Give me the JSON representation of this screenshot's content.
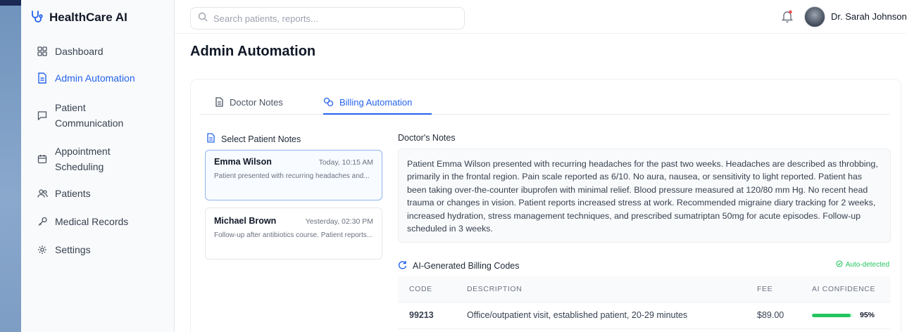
{
  "app": {
    "name": "HealthCare AI"
  },
  "sidebar": {
    "items": [
      {
        "label": "Dashboard",
        "icon": "grid-icon",
        "active": false
      },
      {
        "label": "Admin Automation",
        "icon": "document-icon",
        "active": true
      },
      {
        "label_line1": "Patient",
        "label_line2": "Communication",
        "icon": "message-icon",
        "active": false
      },
      {
        "label_line1": "Appointment",
        "label_line2": "Scheduling",
        "icon": "calendar-icon",
        "active": false
      },
      {
        "label": "Patients",
        "icon": "users-icon",
        "active": false
      },
      {
        "label": "Medical Records",
        "icon": "clipboard-icon",
        "active": false
      },
      {
        "label": "Settings",
        "icon": "gear-icon",
        "active": false
      }
    ]
  },
  "header": {
    "search_placeholder": "Search patients, reports...",
    "user_name": "Dr. Sarah Johnson"
  },
  "main": {
    "title": "Admin Automation",
    "tabs": [
      {
        "label": "Doctor Notes",
        "active": false
      },
      {
        "label": "Billing Automation",
        "active": true
      }
    ],
    "select_notes_title": "Select Patient Notes",
    "notes": [
      {
        "name": "Emma Wilson",
        "time": "Today, 10:15 AM",
        "preview": "Patient presented with recurring headaches and...",
        "selected": true
      },
      {
        "name": "Michael Brown",
        "time": "Yesterday, 02:30 PM",
        "preview": "Follow-up after antibiotics course. Patient reports...",
        "selected": false
      }
    ],
    "doctor_notes_title": "Doctor's Notes",
    "doctor_notes_text": "Patient Emma Wilson presented with recurring headaches for the past two weeks. Headaches are described as throbbing, primarily in the frontal region. Pain scale reported as 6/10. No aura, nausea, or sensitivity to light reported. Patient has been taking over-the-counter ibuprofen with minimal relief. Blood pressure measured at 120/80 mm Hg. No recent head trauma or changes in vision. Patient reports increased stress at work. Recommended migraine diary tracking for 2 weeks, increased hydration, stress management techniques, and prescribed sumatriptan 50mg for acute episodes. Follow-up scheduled in 3 weeks.",
    "billing": {
      "title": "AI-Generated Billing Codes",
      "status": "Auto-detected",
      "columns": [
        "CODE",
        "DESCRIPTION",
        "FEE",
        "AI CONFIDENCE"
      ],
      "rows": [
        {
          "code": "99213",
          "description": "Office/outpatient visit, established patient, 20-29 minutes",
          "fee": "$89.00",
          "confidence": "95%",
          "confidence_value": 0.95
        }
      ]
    }
  },
  "colors": {
    "accent": "#2563eb",
    "success": "#22c55e"
  }
}
